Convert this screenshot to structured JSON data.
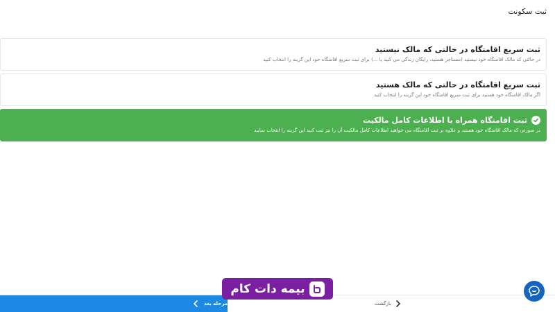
{
  "page": {
    "title": "ثبت سکونت"
  },
  "options": [
    {
      "title": "ثبت سریع اقامتگاه در حالتی که مالک نیستید",
      "description": "در حالتی که مالک اقامتگاه خود نیستید (مستاجر هستید، رایگان زندگی می کنید یا ...) برای ثبت سریع اقامتگاه خود این گزینه را انتخاب کنید",
      "selected": false
    },
    {
      "title": "ثبت سریع اقامتگاه در حالتی که مالک هستید",
      "description": "اگر مالک اقامتگاه خود هستید برای ثبت سریع اقامتگاه خود این گزینه را انتخاب کنید",
      "selected": false
    },
    {
      "title": "ثبت اقامتگاه همراه با اطلاعات کامل مالکیت",
      "description": "در صورتی که مالک اقامتگاه خود هستید و علاوه بر ثبت اقامتگاه می خواهید اطلاعات کامل مالکیت آن را نیز ثبت کنید این گزینه را انتخاب نمایید",
      "selected": true
    }
  ],
  "footer": {
    "next_label": "مرحله بعد",
    "back_label": "بازگشت"
  },
  "watermark": {
    "brand": "بیمه دات کام"
  },
  "colors": {
    "selected_green": "#4caf50",
    "primary_blue": "#1e88e5",
    "brand_purple": "#7b1fa2",
    "chat_blue": "#1565c0"
  },
  "icons": [
    "check-circle-icon",
    "chevron-left-icon",
    "chevron-right-icon",
    "chat-support-icon",
    "brand-logo-icon"
  ]
}
